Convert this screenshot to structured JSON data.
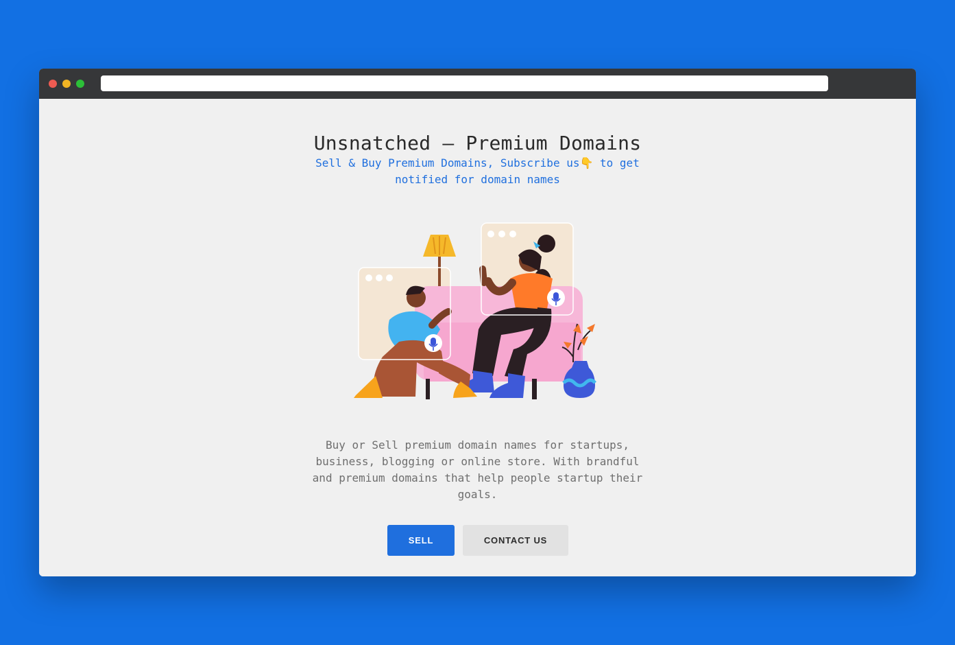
{
  "browser": {
    "address_value": "",
    "colors": {
      "close": "#ee5b52",
      "minimize": "#f1b424",
      "maximize": "#2cbf38",
      "titlebar": "#363739"
    }
  },
  "hero": {
    "title": "Unsnatched – Premium Domains",
    "subtitle": "Sell & Buy Premium Domains, Subscribe us👇 to get notified for domain names",
    "description": "Buy or Sell premium domain names for startups, business, blogging or online store. With brandful and premium domains that help people startup their goals.",
    "illustration": "two-people-video-call-illustration"
  },
  "actions": {
    "sell_label": "SELL",
    "contact_label": "CONTACT US"
  },
  "colors": {
    "background": "#1270e3",
    "page": "#f0f0f0",
    "accent": "#1f6fde",
    "text_dark": "#2a2a2a",
    "text_muted": "#6e6e6e",
    "secondary_button": "#e2e2e2"
  }
}
